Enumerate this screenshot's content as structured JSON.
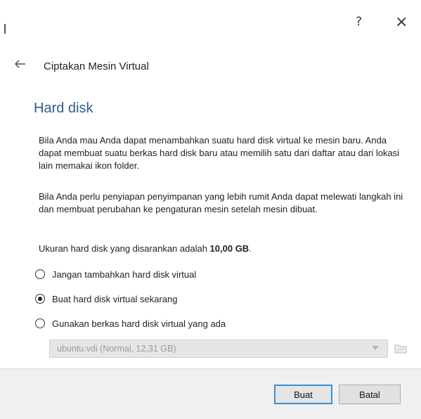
{
  "titlebar": {
    "help_label": "?",
    "close_label": "×"
  },
  "header": {
    "title": "Ciptakan Mesin Virtual"
  },
  "section": {
    "title": "Hard disk"
  },
  "paragraphs": {
    "p1": "Bila Anda mau Anda dapat menambahkan suatu hard disk virtual ke mesin baru. Anda dapat membuat suatu berkas hard disk baru atau memilih satu dari daftar atau dari lokasi lain memakai ikon folder.",
    "p2": "Bila Anda perlu penyiapan penyimpanan yang lebih rumit Anda dapat melewati langkah ini dan membuat perubahan ke pengaturan mesin setelah mesin dibuat."
  },
  "recommend": {
    "prefix": "Ukuran hard disk yang disarankan adalah ",
    "size": "10,00 GB",
    "suffix": "."
  },
  "options": [
    {
      "label": "Jangan tambahkan hard disk virtual",
      "checked": false
    },
    {
      "label": "Buat hard disk virtual sekarang",
      "checked": true
    },
    {
      "label": "Gunakan berkas hard disk virtual yang ada",
      "checked": false
    }
  ],
  "disk_select": {
    "value": "ubuntu.vdi (Normal, 12,31 GB)",
    "enabled": false
  },
  "buttons": {
    "create": "Buat",
    "cancel": "Batal"
  },
  "colors": {
    "title_blue": "#2f5d8a",
    "focus_border": "#3c8fd6",
    "footer_bg": "#f0f0f0"
  },
  "icons": {
    "back": "arrow-left-icon",
    "folder": "folder-icon",
    "dropdown": "chevron-down-icon"
  }
}
